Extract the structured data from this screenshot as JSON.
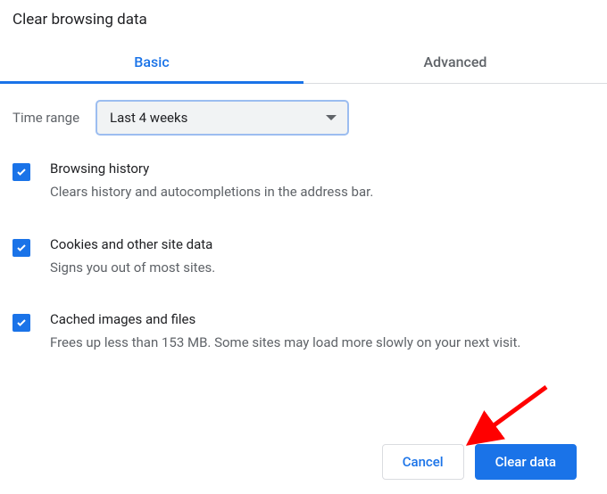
{
  "title": "Clear browsing data",
  "tabs": {
    "basic": "Basic",
    "advanced": "Advanced"
  },
  "time_range": {
    "label": "Time range",
    "selected": "Last 4 weeks"
  },
  "options": [
    {
      "title": "Browsing history",
      "description": "Clears history and autocompletions in the address bar.",
      "checked": true
    },
    {
      "title": "Cookies and other site data",
      "description": "Signs you out of most sites.",
      "checked": true
    },
    {
      "title": "Cached images and files",
      "description": "Frees up less than 153 MB. Some sites may load more slowly on your next visit.",
      "checked": true
    }
  ],
  "buttons": {
    "cancel": "Cancel",
    "clear": "Clear data"
  },
  "annotation": {
    "arrow_color": "#ff0000"
  }
}
